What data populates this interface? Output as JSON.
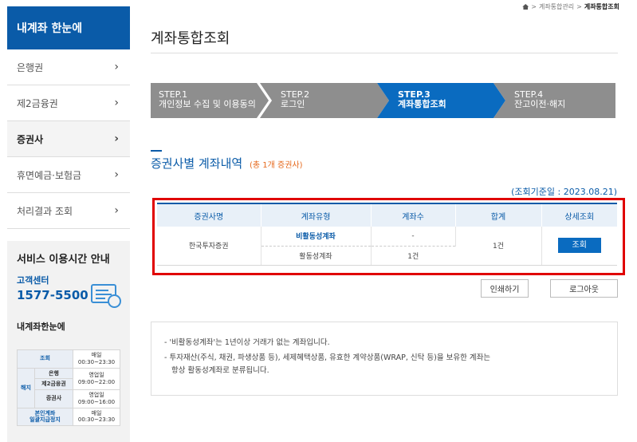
{
  "sidebar": {
    "header": "내계좌 한눈에",
    "items": [
      {
        "label": "은행권"
      },
      {
        "label": "제2금융권"
      },
      {
        "label": "증권사"
      },
      {
        "label": "휴면예금·보험금"
      },
      {
        "label": "처리결과 조회"
      }
    ],
    "chevron": "›",
    "info": {
      "title": "서비스 이용시간 안내",
      "cc_label": "고객센터",
      "cc_phone": "1577-5500",
      "svc_title": "내계좌한눈에",
      "table": {
        "r1_label": "조회",
        "r1_time": "매일\n00:30~23:30",
        "group_label": "해지",
        "r2_label": "은행",
        "r2_time": "영업일\n09:00~22:00",
        "r3_label": "제2금융권",
        "r4_label": "증권사",
        "r4_time": "영업일\n09:00~16:00",
        "r5_label": "본인계좌\n일괄지급정지",
        "r5_time": "매일\n00:30~23:30"
      }
    }
  },
  "breadcrumb": {
    "parent": "계좌통합관리",
    "current": "계좌통합조회",
    "sep": ">"
  },
  "page": {
    "title": "계좌통합조회"
  },
  "steps": [
    {
      "num": "STEP.1",
      "label": "개인정보 수집 및 이용동의"
    },
    {
      "num": "STEP.2",
      "label": "로그인"
    },
    {
      "num": "STEP.3",
      "label": "계좌통합조회"
    },
    {
      "num": "STEP.4",
      "label": "잔고이전·해지"
    }
  ],
  "section": {
    "title": "증권사별 계좌내역",
    "count": "(총 1개 증권사)",
    "ref_date": "(조회기준일 : 2023.08.21)"
  },
  "table": {
    "headers": [
      "증권사명",
      "계좌유형",
      "계좌수",
      "합계",
      "상세조회"
    ],
    "company": "한국투자증권",
    "row1_type": "비활동성계좌",
    "row1_count": "-",
    "row2_type": "활동성계좌",
    "row2_count": "1건",
    "total": "1건",
    "view_label": "조회"
  },
  "buttons": {
    "print": "인쇄하기",
    "logout": "로그아웃"
  },
  "notes": {
    "n1": "- '비활동성계좌'는 1년이상 거래가 없는 계좌입니다.",
    "n2a": "- 투자재산(주식, 채권, 파생상품 등), 세제혜택상품, 유효한 계약상품(WRAP, 신탁 등)을 보유한 계좌는",
    "n2b": "항상 활동성계좌로 분류됩니다."
  },
  "colors": {
    "brand": "#0a5ba8",
    "active_step": "#0a6bc0",
    "inactive_step": "#8e8e8e",
    "highlight_frame": "#e00000",
    "count_accent": "#e66a1e"
  }
}
